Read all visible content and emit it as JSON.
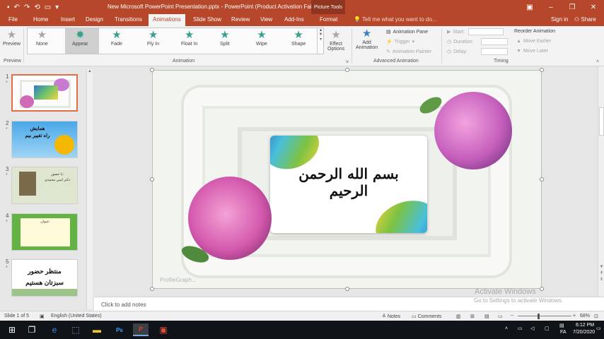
{
  "window": {
    "title": "New Microsoft PowerPoint Presentation.pptx - PowerPoint (Product Activation Fail...",
    "context_tab_group": "Picture Tools",
    "title_bar_color": "#b7472a"
  },
  "tabs": [
    "File",
    "Home",
    "Insert",
    "Design",
    "Transitions",
    "Animations",
    "Slide Show",
    "Review",
    "View",
    "Add-Ins",
    "Format"
  ],
  "active_tab": "Animations",
  "tell_me": "Tell me what you want to do...",
  "sign_in": "Sign in",
  "share": "Share",
  "ribbon": {
    "preview_label": "Preview",
    "preview_group": "Preview",
    "animation_group": "Animation",
    "animations": [
      "None",
      "Appear",
      "Fade",
      "Fly In",
      "Float In",
      "Split",
      "Wipe",
      "Shape"
    ],
    "selected_animation": "Appear",
    "effect_options": [
      "Effect",
      "Options"
    ],
    "add_animation": [
      "Add",
      "Animation"
    ],
    "animation_pane": "Animation Pane",
    "trigger": "Trigger",
    "animation_painter": "Animation Painter",
    "advanced_group": "Advanced Animation",
    "start_label": "Start:",
    "duration_label": "Duration:",
    "delay_label": "Delay:",
    "reorder_label": "Reorder Animation",
    "move_earlier": "Move Earlier",
    "move_later": "Move Later",
    "timing_group": "Timing"
  },
  "thumbnails": [
    {
      "num": "1",
      "star": "*",
      "text": "",
      "selected": true
    },
    {
      "num": "2",
      "star": "*",
      "text": "همایش\nراه تغییر بیم",
      "selected": false
    },
    {
      "num": "3",
      "star": "*",
      "text": "با حضور:\nدکتر امین محمدی",
      "selected": false
    },
    {
      "num": "4",
      "star": "*",
      "text": "عنوان:",
      "selected": false
    },
    {
      "num": "5",
      "star": "*",
      "text": "منتظر حضور\nسبزتان هستیم",
      "selected": false
    }
  ],
  "slide": {
    "calligraphy": "بسم الله الرحمن الرحیم",
    "watermark": "ProfileGraph..."
  },
  "activation": {
    "title": "Activate Windows",
    "subtitle": "Go to Settings to activate Windows."
  },
  "notes_placeholder": "Click to add notes",
  "status": {
    "slide_info": "Slide 1 of 5",
    "language": "English (United States)",
    "notes_btn": "Notes",
    "comments_btn": "Comments",
    "zoom": "68%"
  },
  "taskbar": {
    "time": "6:12 PM",
    "date": "7/20/2020",
    "lang": "FA"
  }
}
